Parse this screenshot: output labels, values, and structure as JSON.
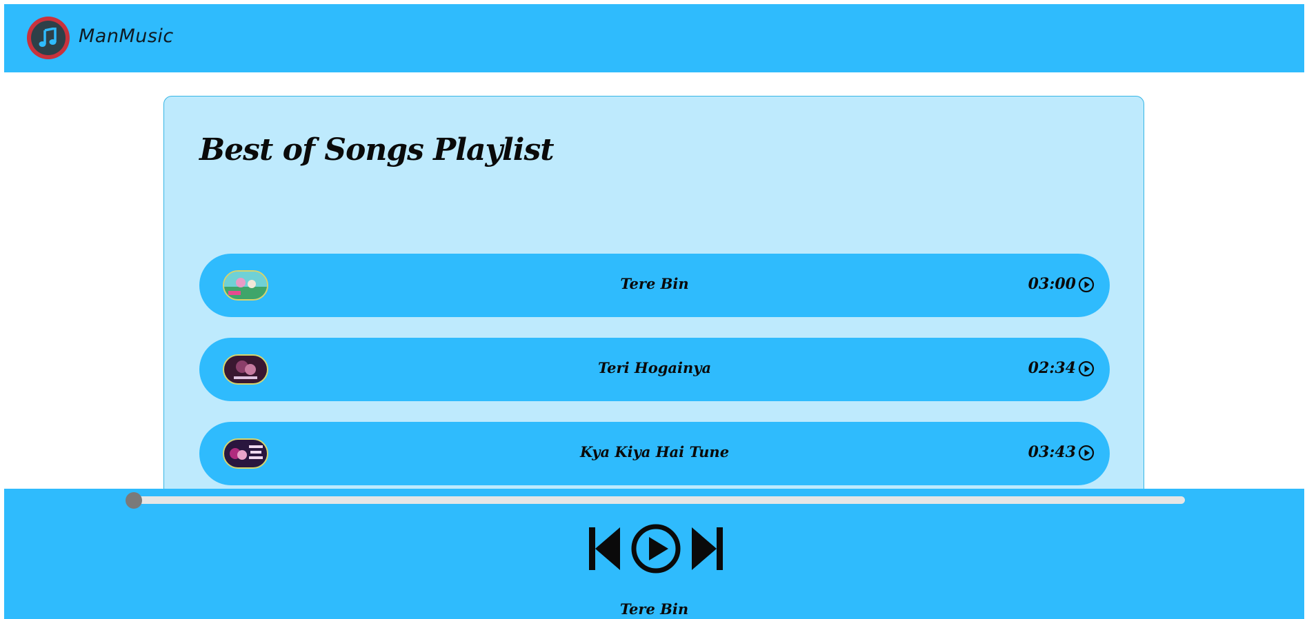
{
  "app": {
    "brand": "ManMusic",
    "logo_icon": "music-note-icon"
  },
  "playlist": {
    "title": "Best of Songs Playlist",
    "songs": [
      {
        "name": "Tere Bin",
        "duration": "03:00",
        "thumb_colors": [
          "#6fd1d6",
          "#e89bc6",
          "#3fa56a"
        ]
      },
      {
        "name": "Teri Hogainya",
        "duration": "02:34",
        "thumb_colors": [
          "#3a1730",
          "#8b3f6a",
          "#c77aa0"
        ]
      },
      {
        "name": "Kya Kiya Hai Tune",
        "duration": "03:43",
        "thumb_colors": [
          "#2a163e",
          "#b02c7e",
          "#e8a3c9"
        ]
      }
    ]
  },
  "player": {
    "progress": 0.0,
    "now_playing": "Tere Bin",
    "icons": {
      "previous": "skip-previous-icon",
      "play": "play-circle-icon",
      "next": "skip-next-icon"
    }
  },
  "colors": {
    "accent": "#2fbbfd",
    "panel": "#beeafd",
    "logo_ring": "#c9323c"
  }
}
